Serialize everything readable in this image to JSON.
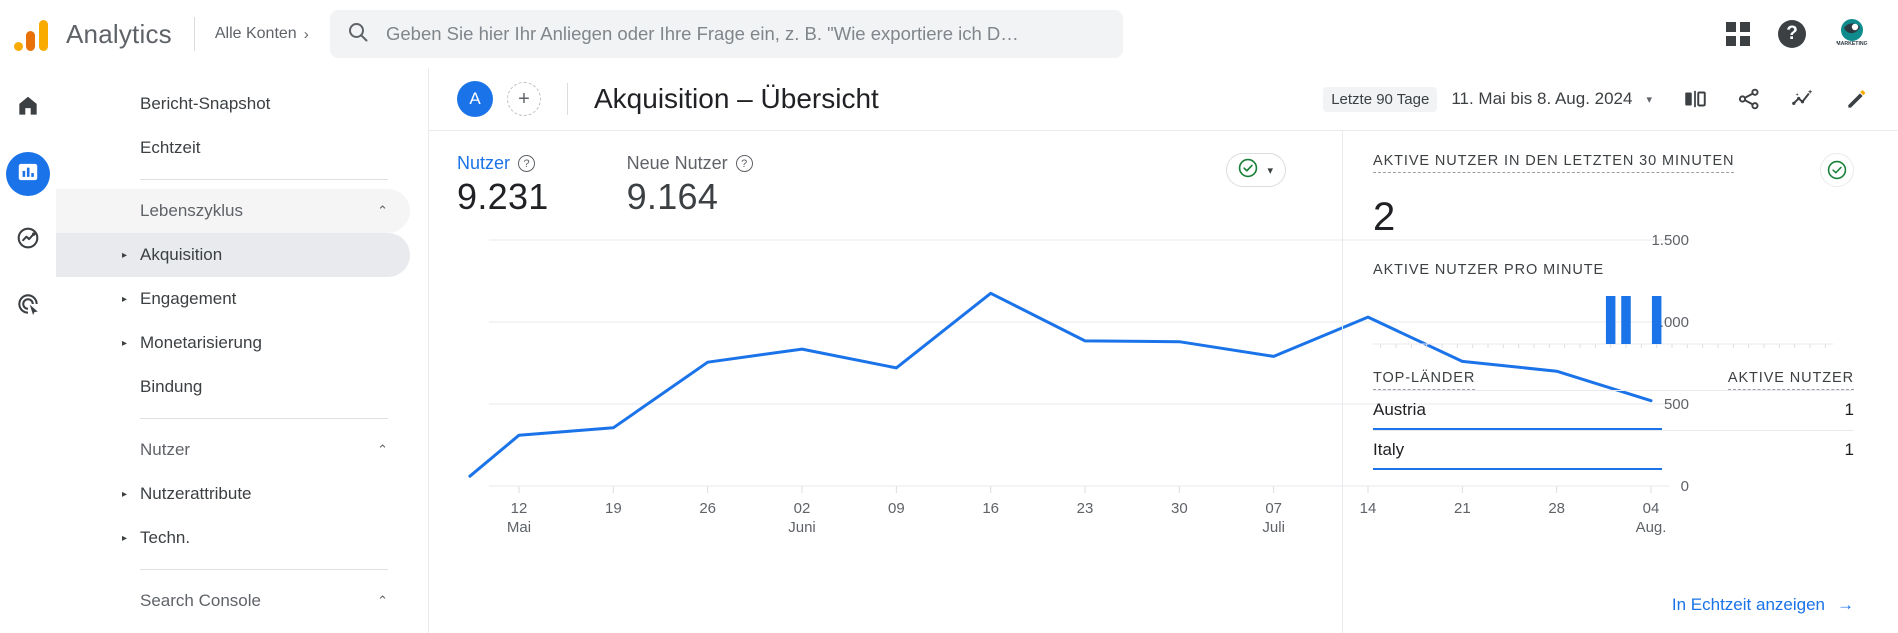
{
  "topbar": {
    "brand_name": "Analytics",
    "logo_icon": "analytics-logo-icon",
    "account_label": "Alle Konten",
    "account_chevron": "›",
    "search": {
      "icon": "search-icon",
      "placeholder": "Geben Sie hier Ihr Anliegen oder Ihre Frage ein, z. B. \"Wie exportiere ich D…"
    },
    "apps_icon": "apps-grid-icon",
    "help_icon": "help-icon",
    "help_glyph": "?",
    "avatar_icon": "account-avatar-icon"
  },
  "rail": {
    "items": [
      {
        "name": "home",
        "icon": "home-icon",
        "active": false
      },
      {
        "name": "reports",
        "icon": "bar-chart-icon",
        "active": true
      },
      {
        "name": "explore",
        "icon": "explore-trend-icon",
        "active": false
      },
      {
        "name": "advertising",
        "icon": "advertising-target-icon",
        "active": false
      }
    ]
  },
  "sidebar": {
    "items": [
      {
        "label": "Bericht-Snapshot",
        "type": "item"
      },
      {
        "label": "Echtzeit",
        "type": "item"
      },
      {
        "label": "Lebenszyklus",
        "type": "section",
        "caret": "⌃"
      },
      {
        "label": "Akquisition",
        "type": "sub",
        "arrow": "▸",
        "selected": true
      },
      {
        "label": "Engagement",
        "type": "sub",
        "arrow": "▸"
      },
      {
        "label": "Monetarisierung",
        "type": "sub",
        "arrow": "▸"
      },
      {
        "label": "Bindung",
        "type": "leaf"
      },
      {
        "label": "Nutzer",
        "type": "section",
        "caret": "⌃"
      },
      {
        "label": "Nutzerattribute",
        "type": "sub",
        "arrow": "▸"
      },
      {
        "label": "Techn.",
        "type": "sub",
        "arrow": "▸"
      },
      {
        "label": "Search Console",
        "type": "section",
        "caret": "⌃"
      }
    ]
  },
  "main_header": {
    "avatar_letter": "A",
    "add_button": "+",
    "title": "Akquisition – Übersicht",
    "date_range_label": "Letzte 90 Tage",
    "date_range_value": "11. Mai bis 8. Aug. 2024",
    "date_caret": "▾",
    "tools": [
      {
        "name": "compare-icon",
        "label": "Vergleich"
      },
      {
        "name": "share-icon",
        "label": "Freigeben"
      },
      {
        "name": "insights-icon",
        "label": "Statistiken"
      },
      {
        "name": "edit-pencil-icon",
        "label": "Bearbeiten"
      }
    ]
  },
  "metrics": [
    {
      "label": "Nutzer",
      "value": "9.231",
      "active": true,
      "help_icon": "help-circle-icon"
    },
    {
      "label": "Neue Nutzer",
      "value": "9.164",
      "active": false,
      "help_icon": "help-circle-icon"
    }
  ],
  "status_pill": {
    "icon": "check-circle-icon",
    "caret": "▾",
    "color": "#188038"
  },
  "chart_data": {
    "type": "line",
    "title": "Nutzer",
    "xlabel": "",
    "ylabel": "",
    "ylim": [
      0,
      1500
    ],
    "yticks": [
      0,
      500,
      1000,
      1500
    ],
    "ytick_labels": [
      "0",
      "500",
      "1.000",
      "1.500"
    ],
    "grid": true,
    "legend": false,
    "line_color": "#1a73e8",
    "categories": [
      "12",
      "19",
      "26",
      "02",
      "09",
      "16",
      "23",
      "30",
      "07",
      "14",
      "21",
      "28",
      "04"
    ],
    "tick_months": [
      "Mai",
      "",
      "",
      "Juni",
      "",
      "",
      "",
      "",
      "Juli",
      "",
      "",
      "",
      "Aug."
    ],
    "series": [
      {
        "name": "Nutzer",
        "values": [
          60,
          310,
          355,
          755,
          835,
          720,
          1175,
          885,
          880,
          790,
          1030,
          760,
          700,
          520
        ]
      }
    ],
    "note": "Erster Punkt liegt links vor dem Tick '12 Mai' (Teilwoche)."
  },
  "realtime": {
    "headline": "Aktive Nutzer in den letzten 30 Minuten",
    "headline_upper": "AKTIVE NUTZER IN DEN LETZTEN 30 MINUTEN",
    "status_icon": "check-circle-icon",
    "value": "2",
    "per_minute_label": "AKTIVE NUTZER PRO MINUTE",
    "per_minute_chart": {
      "type": "bar",
      "bar_color": "#1a73e8",
      "minutes": 30,
      "values": [
        0,
        0,
        0,
        0,
        0,
        0,
        0,
        0,
        0,
        0,
        0,
        0,
        0,
        0,
        0,
        1,
        1,
        0,
        1,
        0,
        0,
        0,
        0,
        0,
        0,
        0,
        0,
        0,
        0,
        0
      ]
    },
    "table": {
      "columns": [
        "TOP-LÄNDER",
        "AKTIVE NUTZER"
      ],
      "rows": [
        {
          "country": "Austria",
          "users": "1",
          "bar_pct": 100
        },
        {
          "country": "Italy",
          "users": "1",
          "bar_pct": 100
        }
      ]
    },
    "footer_link": "In Echtzeit anzeigen",
    "footer_arrow": "→"
  },
  "colors": {
    "accent_blue": "#1a73e8",
    "green": "#188038",
    "logo_orange": "#e8710a",
    "logo_yellow": "#f9ab00",
    "text_primary": "#202124",
    "text_secondary": "#5f6368"
  }
}
